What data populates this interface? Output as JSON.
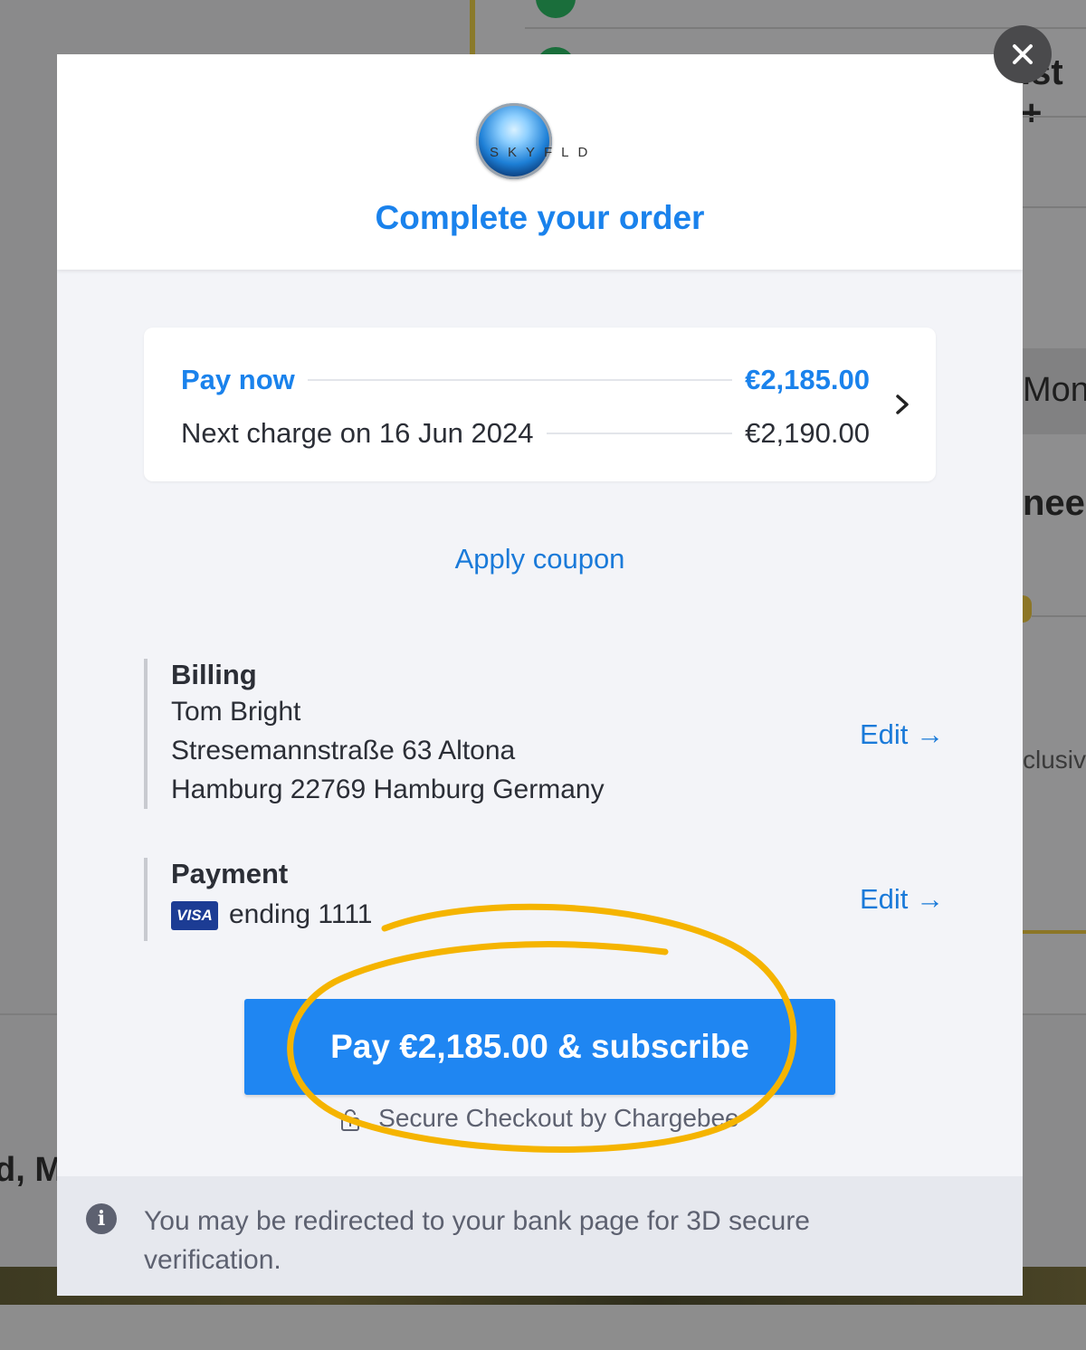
{
  "background": {
    "fragment_right_1": "ıst +",
    "fragment_right_2": "Mont",
    "fragment_right_3": "neec",
    "fragment_right_4": "clusiv",
    "fragment_left": "d, M"
  },
  "modal": {
    "brand_text": "SKYFLD",
    "title": "Complete your order",
    "summary": {
      "pay_now_label": "Pay now",
      "pay_now_amount": "€2,185.00",
      "next_charge_label": "Next charge on 16 Jun 2024",
      "next_charge_amount": "€2,190.00"
    },
    "apply_coupon": "Apply coupon",
    "billing": {
      "title": "Billing",
      "name": "Tom Bright",
      "address_line1": "Stresemannstraße 63 Altona",
      "address_line2": "Hamburg 22769 Hamburg Germany",
      "edit_label": "Edit →"
    },
    "payment": {
      "title": "Payment",
      "card_brand": "VISA",
      "card_ending": "ending 1111",
      "edit_label": "Edit →"
    },
    "pay_button": "Pay €2,185.00 & subscribe",
    "secure_checkout": "Secure Checkout by Chargebee",
    "notice": "You may be redirected to your bank page for 3D secure verification."
  },
  "colors": {
    "accent": "#1a82ec",
    "button": "#1f86f2",
    "highlight": "#f5b400"
  },
  "icons": [
    "close-icon",
    "chevron-right-icon",
    "lock-icon",
    "info-icon",
    "visa-card-icon",
    "brand-logo"
  ]
}
